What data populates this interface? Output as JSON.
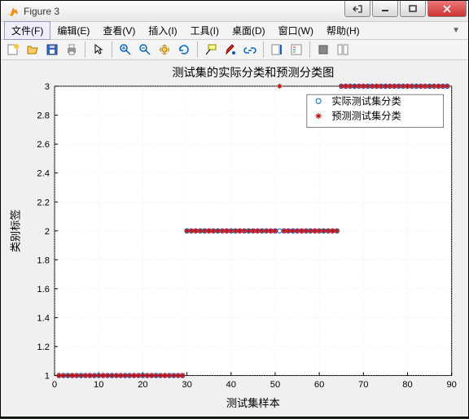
{
  "window": {
    "title": "Figure 3"
  },
  "menu": {
    "file": "文件(F)",
    "edit": "编辑(E)",
    "view": "查看(V)",
    "insert": "插入(I)",
    "tools": "工具(I)",
    "desktop": "桌面(D)",
    "window": "窗口(W)",
    "help": "帮助(H)"
  },
  "legend": {
    "actual": "实际测试集分类",
    "predicted": "预测测试集分类"
  },
  "chart_data": {
    "type": "scatter",
    "title": "测试集的实际分类和预测分类图",
    "xlabel": "测试集样本",
    "ylabel": "类别标签",
    "xlim": [
      0,
      90
    ],
    "ylim": [
      1,
      3
    ],
    "xticks": [
      0,
      10,
      20,
      30,
      40,
      50,
      60,
      70,
      80,
      90
    ],
    "yticks": [
      1,
      1.2,
      1.4,
      1.6,
      1.8,
      2,
      2.2,
      2.4,
      2.6,
      2.8,
      3
    ],
    "series": [
      {
        "name": "实际测试集分类",
        "marker": "circle",
        "color": "#0066cc",
        "x": [
          1,
          2,
          3,
          4,
          5,
          6,
          7,
          8,
          9,
          10,
          11,
          12,
          13,
          14,
          15,
          16,
          17,
          18,
          19,
          20,
          21,
          22,
          23,
          24,
          25,
          26,
          27,
          28,
          29,
          30,
          31,
          32,
          33,
          34,
          35,
          36,
          37,
          38,
          39,
          40,
          41,
          42,
          43,
          44,
          45,
          46,
          47,
          48,
          49,
          50,
          51,
          52,
          53,
          54,
          55,
          56,
          57,
          58,
          59,
          60,
          61,
          62,
          63,
          64,
          65,
          66,
          67,
          68,
          69,
          70,
          71,
          72,
          73,
          74,
          75,
          76,
          77,
          78,
          79,
          80,
          81,
          82,
          83,
          84,
          85,
          86,
          87,
          88,
          89
        ],
        "y": [
          1,
          1,
          1,
          1,
          1,
          1,
          1,
          1,
          1,
          1,
          1,
          1,
          1,
          1,
          1,
          1,
          1,
          1,
          1,
          1,
          1,
          1,
          1,
          1,
          1,
          1,
          1,
          1,
          1,
          2,
          2,
          2,
          2,
          2,
          2,
          2,
          2,
          2,
          2,
          2,
          2,
          2,
          2,
          2,
          2,
          2,
          2,
          2,
          2,
          2,
          2,
          2,
          2,
          2,
          2,
          2,
          2,
          2,
          2,
          2,
          2,
          2,
          2,
          2,
          3,
          3,
          3,
          3,
          3,
          3,
          3,
          3,
          3,
          3,
          3,
          3,
          3,
          3,
          3,
          3,
          3,
          3,
          3,
          3,
          3,
          3,
          3,
          3,
          3
        ]
      },
      {
        "name": "预测测试集分类",
        "marker": "star",
        "color": "#cc0000",
        "x": [
          1,
          2,
          3,
          4,
          5,
          6,
          7,
          8,
          9,
          10,
          11,
          12,
          13,
          14,
          15,
          16,
          17,
          18,
          19,
          20,
          21,
          22,
          23,
          24,
          25,
          26,
          27,
          28,
          29,
          30,
          31,
          32,
          33,
          34,
          35,
          36,
          37,
          38,
          39,
          40,
          41,
          42,
          43,
          44,
          45,
          46,
          47,
          48,
          49,
          50,
          51,
          52,
          53,
          54,
          55,
          56,
          57,
          58,
          59,
          60,
          61,
          62,
          63,
          64,
          65,
          66,
          67,
          68,
          69,
          70,
          71,
          72,
          73,
          74,
          75,
          76,
          77,
          78,
          79,
          80,
          81,
          82,
          83,
          84,
          85,
          86,
          87,
          88,
          89
        ],
        "y": [
          1,
          1,
          1,
          1,
          1,
          1,
          1,
          1,
          1,
          1,
          1,
          1,
          1,
          1,
          1,
          1,
          1,
          1,
          1,
          1,
          1,
          1,
          1,
          1,
          1,
          1,
          1,
          1,
          1,
          2,
          2,
          2,
          2,
          2,
          2,
          2,
          2,
          2,
          2,
          2,
          2,
          2,
          2,
          2,
          2,
          2,
          2,
          2,
          2,
          2,
          3,
          2,
          2,
          2,
          2,
          2,
          2,
          2,
          2,
          2,
          2,
          2,
          2,
          2,
          3,
          3,
          3,
          3,
          3,
          3,
          3,
          3,
          3,
          3,
          3,
          3,
          3,
          3,
          3,
          3,
          3,
          3,
          3,
          3,
          3,
          3,
          3,
          3,
          3
        ]
      }
    ]
  }
}
